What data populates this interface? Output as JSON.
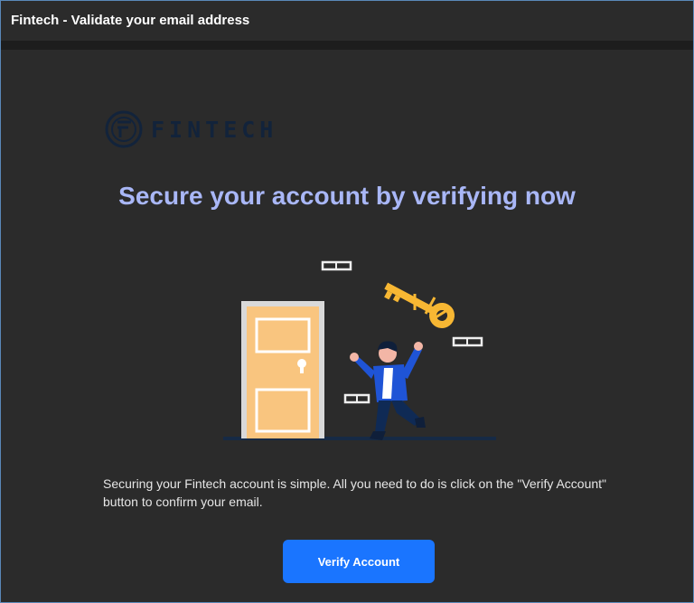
{
  "window": {
    "title": "Fintech - Validate your email address"
  },
  "email": {
    "logo_text": "FINTECH",
    "headline": "Secure your account by verifying now",
    "body": "Securing your Fintech account is simple. All you need to do is click on the \"Verify Account\" button to confirm your email.",
    "button_label": "Verify Account"
  },
  "colors": {
    "background": "#2b2b2b",
    "headline": "#a9b7f7",
    "button": "#1a75ff",
    "logo": "#12233b",
    "door": "#f9c57f",
    "key": "#f7b733"
  },
  "icons": {
    "logo": "fintech-logo-icon",
    "illustration": "door-key-illustration"
  }
}
